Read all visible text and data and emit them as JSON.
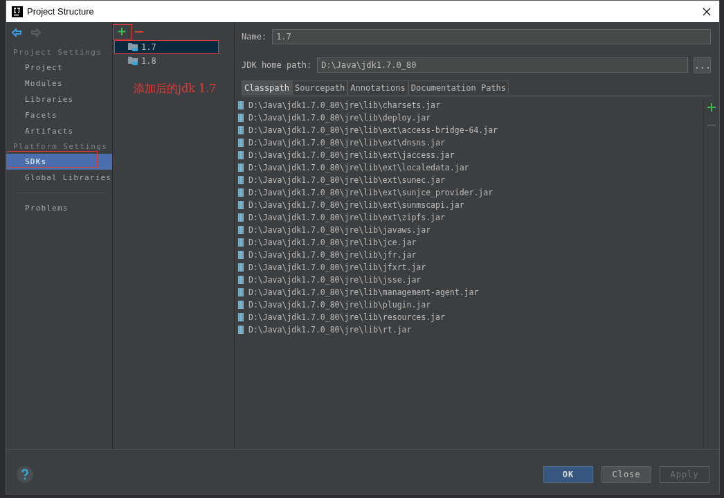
{
  "window": {
    "title": "Project Structure"
  },
  "sidebar": {
    "sections": [
      {
        "heading": "Project Settings",
        "items": [
          {
            "label": "Project",
            "selected": false
          },
          {
            "label": "Modules",
            "selected": false
          },
          {
            "label": "Libraries",
            "selected": false
          },
          {
            "label": "Facets",
            "selected": false
          },
          {
            "label": "Artifacts",
            "selected": false
          }
        ]
      },
      {
        "heading": "Platform Settings",
        "items": [
          {
            "label": "SDKs",
            "selected": true
          },
          {
            "label": "Global Libraries",
            "selected": false
          }
        ]
      }
    ],
    "extra_items": [
      {
        "label": "Problems",
        "selected": false
      }
    ]
  },
  "sdk_list": [
    {
      "label": "1.7",
      "selected": true
    },
    {
      "label": "1.8",
      "selected": false
    }
  ],
  "annotation": "添加后的jdk 1.7",
  "name_field": {
    "label": "Name:",
    "value": "1.7"
  },
  "home_path": {
    "label": "JDK home path:",
    "value": "D:\\Java\\jdk1.7.0_80",
    "browse": "..."
  },
  "tabs": [
    {
      "label": "Classpath",
      "selected": true
    },
    {
      "label": "Sourcepath",
      "selected": false
    },
    {
      "label": "Annotations",
      "selected": false
    },
    {
      "label": "Documentation Paths",
      "selected": false
    }
  ],
  "classpath": [
    "D:\\Java\\jdk1.7.0_80\\jre\\lib\\charsets.jar",
    "D:\\Java\\jdk1.7.0_80\\jre\\lib\\deploy.jar",
    "D:\\Java\\jdk1.7.0_80\\jre\\lib\\ext\\access-bridge-64.jar",
    "D:\\Java\\jdk1.7.0_80\\jre\\lib\\ext\\dnsns.jar",
    "D:\\Java\\jdk1.7.0_80\\jre\\lib\\ext\\jaccess.jar",
    "D:\\Java\\jdk1.7.0_80\\jre\\lib\\ext\\localedata.jar",
    "D:\\Java\\jdk1.7.0_80\\jre\\lib\\ext\\sunec.jar",
    "D:\\Java\\jdk1.7.0_80\\jre\\lib\\ext\\sunjce_provider.jar",
    "D:\\Java\\jdk1.7.0_80\\jre\\lib\\ext\\sunmscapi.jar",
    "D:\\Java\\jdk1.7.0_80\\jre\\lib\\ext\\zipfs.jar",
    "D:\\Java\\jdk1.7.0_80\\jre\\lib\\javaws.jar",
    "D:\\Java\\jdk1.7.0_80\\jre\\lib\\jce.jar",
    "D:\\Java\\jdk1.7.0_80\\jre\\lib\\jfr.jar",
    "D:\\Java\\jdk1.7.0_80\\jre\\lib\\jfxrt.jar",
    "D:\\Java\\jdk1.7.0_80\\jre\\lib\\jsse.jar",
    "D:\\Java\\jdk1.7.0_80\\jre\\lib\\management-agent.jar",
    "D:\\Java\\jdk1.7.0_80\\jre\\lib\\plugin.jar",
    "D:\\Java\\jdk1.7.0_80\\jre\\lib\\resources.jar",
    "D:\\Java\\jdk1.7.0_80\\jre\\lib\\rt.jar"
  ],
  "buttons": [
    {
      "label": "OK",
      "kind": "primary"
    },
    {
      "label": "Close",
      "kind": "normal"
    },
    {
      "label": "Apply",
      "kind": "disabled"
    }
  ]
}
